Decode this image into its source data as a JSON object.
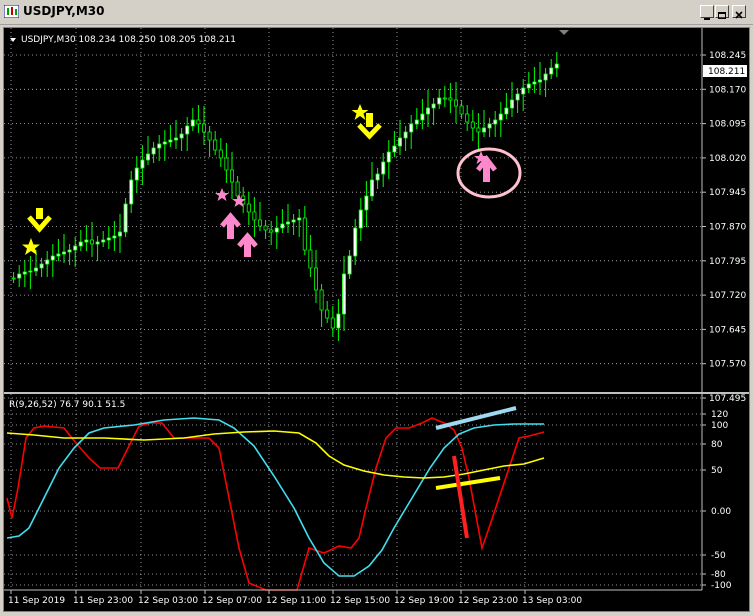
{
  "window": {
    "title": "USDJPY,M30",
    "controls": [
      "minimize",
      "restore",
      "close"
    ]
  },
  "price_chart": {
    "header": "USDJPY,M30  108.234 108.250 108.205 108.211",
    "current_price": "108.211",
    "price_labels": [
      "108.245",
      "108.170",
      "108.095",
      "108.020",
      "107.945",
      "107.870",
      "107.795",
      "107.720",
      "107.645",
      "107.570",
      "107.495"
    ],
    "colors": {
      "bull": "#ffffff",
      "bear": "#00ff00",
      "wick": "#00ff00",
      "grid": "#c0c0c0",
      "background": "#000000"
    }
  },
  "indicator": {
    "header": "R(9,26,52) 76.7 90.1 51.5",
    "levels": [
      "120",
      "100",
      "80",
      "50",
      "0.00",
      "-50",
      "-80",
      "-100"
    ],
    "colors": {
      "fast": "#ff0000",
      "medium": "#40e0f0",
      "slow": "#ffff00"
    }
  },
  "time_labels": [
    "11 Sep 2019",
    "11 Sep 23:00",
    "12 Sep 03:00",
    "12 Sep 07:00",
    "12 Sep 11:00",
    "12 Sep 15:00",
    "12 Sep 19:00",
    "12 Sep 23:00",
    "13 Sep 03:00"
  ],
  "annotations": {
    "colors": {
      "yellow": "#ffff00",
      "pink": "#ff88cc",
      "light_blue": "#a0d8f0",
      "circle": "#ffc0d0"
    },
    "icons": [
      "star-icon",
      "arrow-down-icon",
      "arrow-up-icon",
      "circle-highlight"
    ]
  }
}
